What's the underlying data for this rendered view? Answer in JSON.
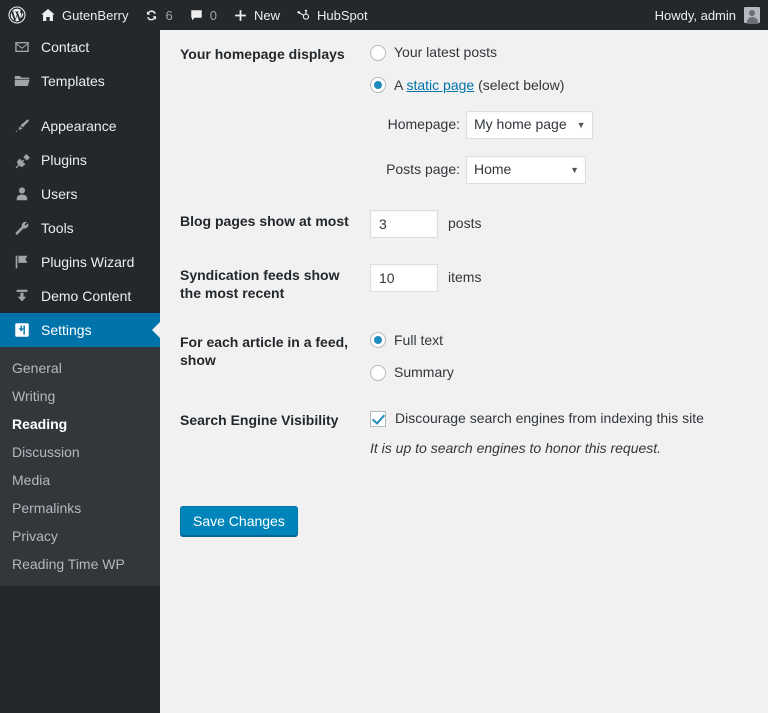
{
  "adminbar": {
    "wp_logo_icon": "wordpress-logo-icon",
    "site_name": "GutenBerry",
    "site_icon": "home-icon",
    "updates_icon": "updates-icon",
    "updates_count": "6",
    "comments_icon": "comment-bubble-icon",
    "comments_count": "0",
    "new_icon": "plus-icon",
    "new_label": "New",
    "hubspot_icon": "hubspot-icon",
    "hubspot_label": "HubSpot",
    "howdy": "Howdy, admin",
    "avatar_icon": "avatar-icon"
  },
  "sidebar": {
    "items": [
      {
        "label": "Contact",
        "icon": "envelope-icon",
        "current": false
      },
      {
        "label": "Templates",
        "icon": "folder-icon",
        "current": false
      },
      {
        "label": "Appearance",
        "icon": "paintbrush-icon",
        "current": false
      },
      {
        "label": "Plugins",
        "icon": "plug-icon",
        "current": false
      },
      {
        "label": "Users",
        "icon": "user-icon",
        "current": false
      },
      {
        "label": "Tools",
        "icon": "wrench-icon",
        "current": false
      },
      {
        "label": "Plugins Wizard",
        "icon": "flag-icon",
        "current": false
      },
      {
        "label": "Demo Content",
        "icon": "download-icon",
        "current": false
      },
      {
        "label": "Settings",
        "icon": "settings-icon",
        "current": true
      }
    ],
    "submenu": [
      {
        "label": "General",
        "current": false
      },
      {
        "label": "Writing",
        "current": false
      },
      {
        "label": "Reading",
        "current": true
      },
      {
        "label": "Discussion",
        "current": false
      },
      {
        "label": "Media",
        "current": false
      },
      {
        "label": "Permalinks",
        "current": false
      },
      {
        "label": "Privacy",
        "current": false
      },
      {
        "label": "Reading Time WP",
        "current": false
      }
    ]
  },
  "settings": {
    "homepage_displays": {
      "label": "Your homepage displays",
      "option_latest_posts": "Your latest posts",
      "option_latest_posts_checked": false,
      "option_static_prefix": "A ",
      "option_static_link": "static page",
      "option_static_suffix": " (select below)",
      "option_static_checked": true,
      "homepage_label": "Homepage:",
      "homepage_value": "My home page",
      "posts_page_label": "Posts page:",
      "posts_page_value": "Home",
      "caret": "▼"
    },
    "blog_pages": {
      "label": "Blog pages show at most",
      "value": "3",
      "unit": "posts"
    },
    "syndication": {
      "label": "Syndication feeds show the most recent",
      "value": "10",
      "unit": "items"
    },
    "feed_show": {
      "label": "For each article in a feed, show",
      "option_full": "Full text",
      "option_full_checked": true,
      "option_summary": "Summary",
      "option_summary_checked": false
    },
    "search_visibility": {
      "label": "Search Engine Visibility",
      "checkbox_label": "Discourage search engines from indexing this site",
      "checked": true,
      "description": "It is up to search engines to honor this request."
    },
    "save_label": "Save Changes"
  },
  "colors": {
    "accent": "#0073aa",
    "button": "#0085ba",
    "sidebar_bg": "#23282d",
    "submenu_bg": "#32373c",
    "content_bg": "#f1f1f1",
    "link": "#0073aa"
  }
}
